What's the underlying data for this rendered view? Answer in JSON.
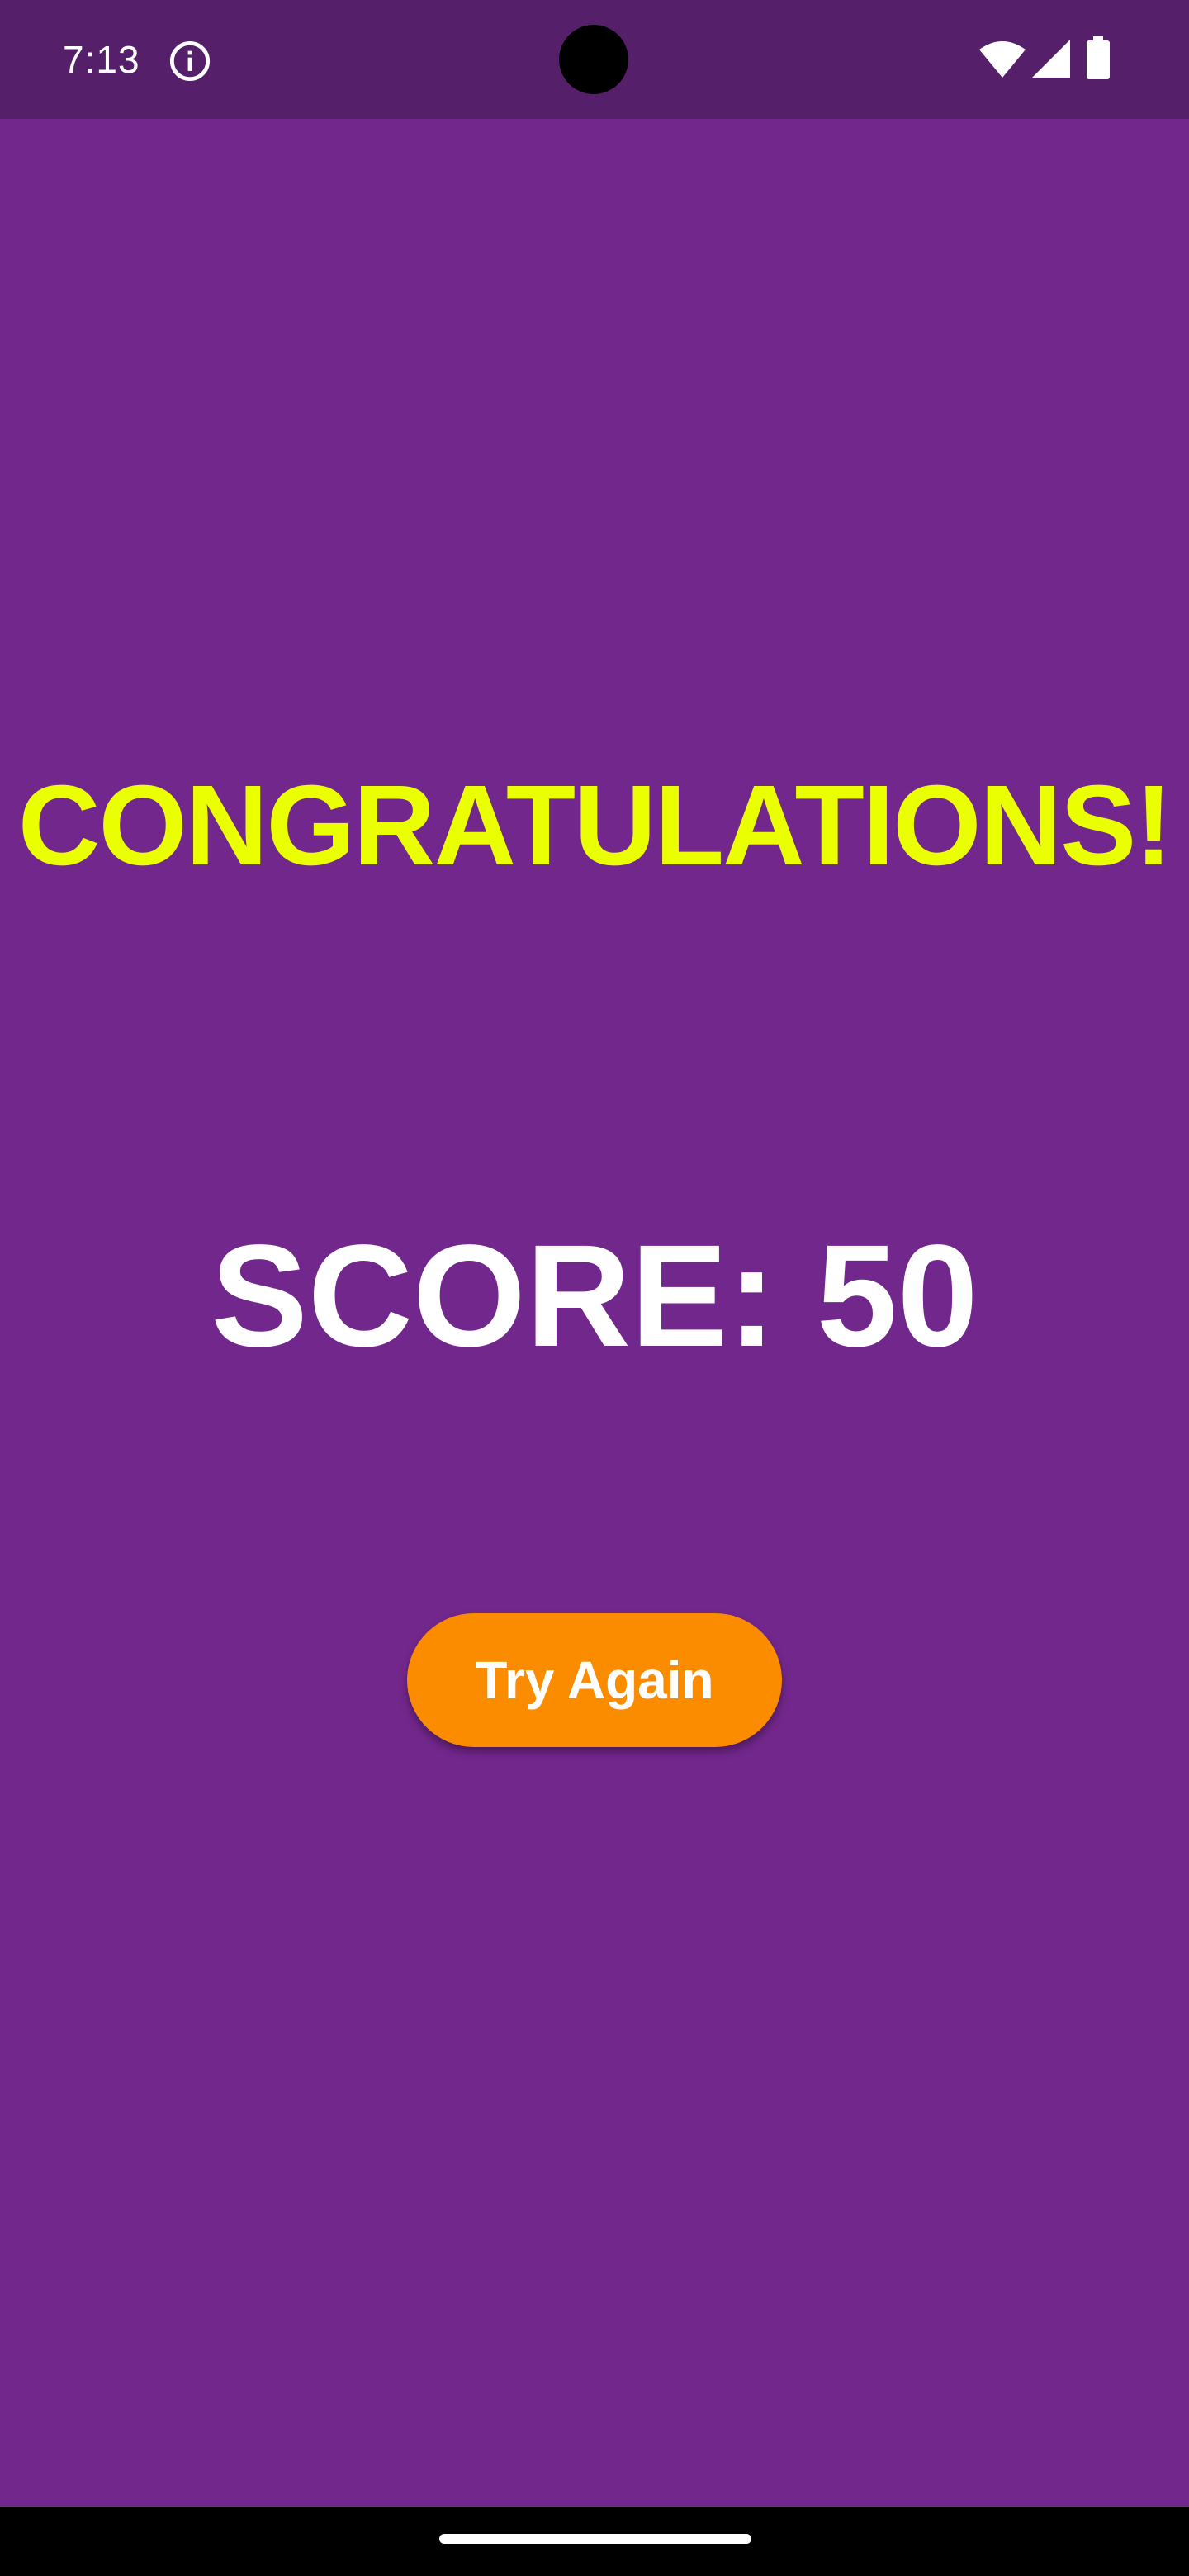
{
  "status_bar": {
    "time": "7:13",
    "icons": [
      "info-icon",
      "wifi-icon",
      "signal-icon",
      "battery-icon"
    ]
  },
  "main": {
    "headline": "CONGRATULATIONS!",
    "score_text": "SCORE: 50",
    "try_again_label": "Try Again"
  },
  "colors": {
    "background": "#72278c",
    "status_bar": "#561f6a",
    "headline": "#eaff00",
    "button": "#fb8c00",
    "text": "#ffffff"
  }
}
